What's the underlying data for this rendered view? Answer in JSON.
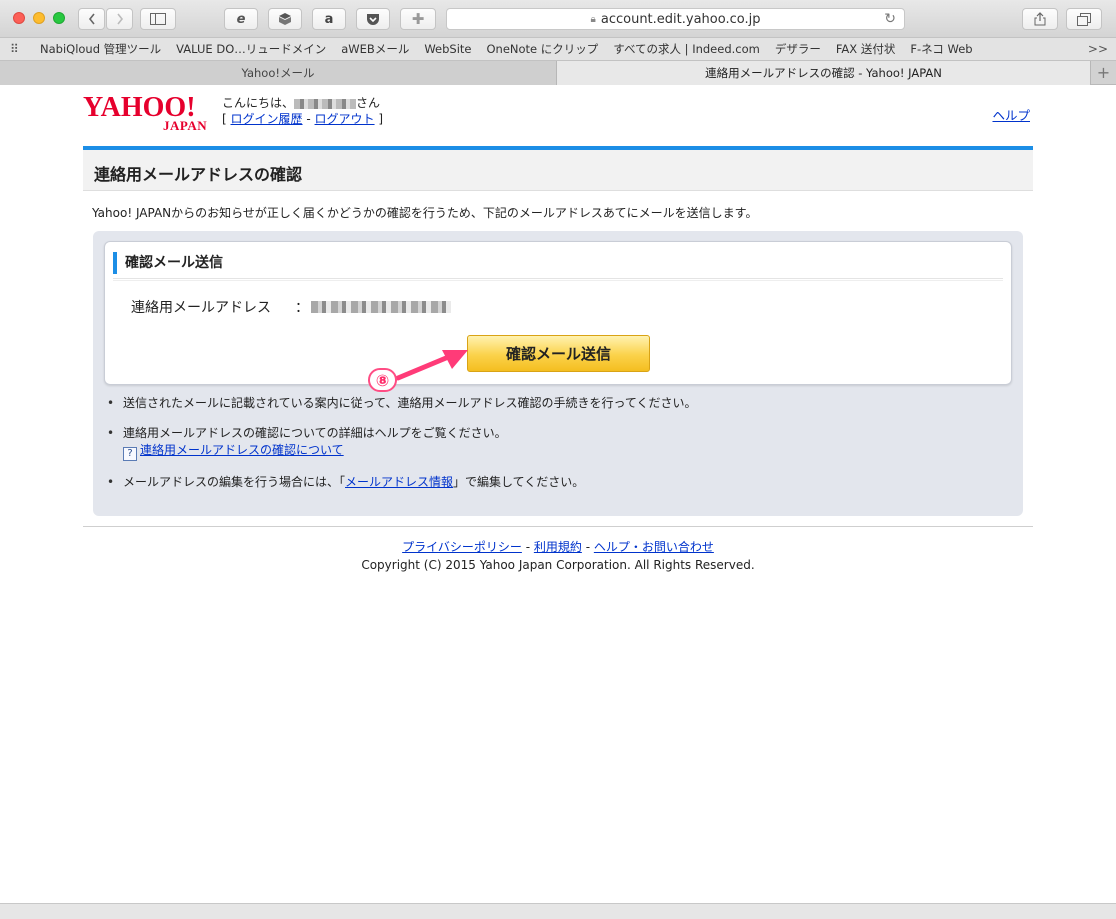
{
  "browser": {
    "url": "account.edit.yahoo.co.jp",
    "bookmarks": [
      "NabiQloud 管理ツール",
      "VALUE DO…リュードメイン",
      "aWEBメール",
      "WebSite",
      "OneNote にクリップ",
      "すべての求人 | Indeed.com",
      "デザラー",
      "FAX 送付状",
      "F-ネコ Web"
    ],
    "bookmarks_more": ">>",
    "tabs": [
      "Yahoo!メール",
      "連絡用メールアドレスの確認 - Yahoo! JAPAN"
    ],
    "new_tab": "+"
  },
  "header": {
    "logo_main": "YAHOO!",
    "logo_sub": "JAPAN",
    "greeting_prefix": "こんにちは、",
    "greeting_suffix": "さん",
    "bracket_open": "[",
    "login_history": "ログイン履歴",
    "separator": "-",
    "logout": "ログアウト",
    "bracket_close": "]",
    "help": "ヘルプ"
  },
  "main": {
    "title": "連絡用メールアドレスの確認",
    "intro": "Yahoo! JAPANからのお知らせが正しく届くかどうかの確認を行うため、下記のメールアドレスあてにメールを送信します。",
    "section_title": "確認メール送信",
    "field_label": "連絡用メールアドレス",
    "field_sep": "：",
    "send_button": "確認メール送信",
    "marker": "⑧",
    "notes": {
      "n1": "送信されたメールに記載されている案内に従って、連絡用メールアドレス確認の手続きを行ってください。",
      "n2": "連絡用メールアドレスの確認についての詳細はヘルプをご覧ください。",
      "n2_link": "連絡用メールアドレスの確認について",
      "n3_pre": "メールアドレスの編集を行う場合には、「",
      "n3_link": "メールアドレス情報",
      "n3_post": "」で編集してください。"
    }
  },
  "footer": {
    "privacy": "プライバシーポリシー",
    "sep1": " - ",
    "terms": "利用規約",
    "sep2": " - ",
    "help_contact": "ヘルプ・お問い合わせ",
    "copyright": "Copyright (C) 2015 Yahoo Japan Corporation. All Rights Reserved."
  },
  "colors": {
    "accent_blue": "#1c8ee6",
    "link": "#0033cc",
    "button_yellow": "#fbd24a",
    "marker_pink": "#ff2d6a",
    "yahoo_red": "#e6002d"
  }
}
